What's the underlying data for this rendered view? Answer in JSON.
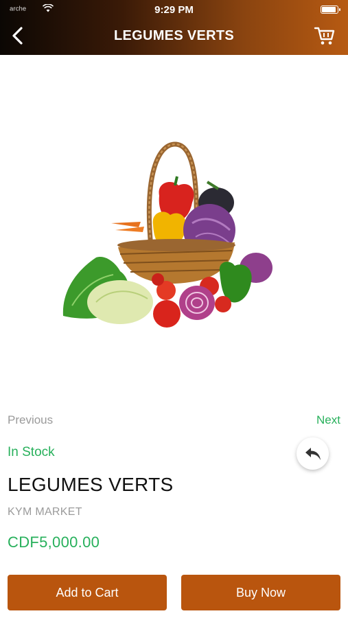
{
  "status_bar": {
    "carrier": "ᵃʳᶜʰᵉ",
    "time": "9:29 PM"
  },
  "header": {
    "title": "LEGUMES VERTS"
  },
  "image": {
    "subject": "basket of vegetables"
  },
  "pager": {
    "previous_label": "Previous",
    "next_label": "Next"
  },
  "product": {
    "stock_status": "In Stock",
    "name": "LEGUMES VERTS",
    "vendor": "KYM MARKET",
    "price": "CDF5,000.00"
  },
  "actions": {
    "add_to_cart_label": "Add to Cart",
    "buy_now_label": "Buy Now"
  },
  "colors": {
    "accent": "#b9550e",
    "in_stock": "#27b05b",
    "muted": "#9a9a9a"
  },
  "icons": {
    "back": "chevron-left-icon",
    "cart": "cart-icon",
    "share": "reply-icon"
  }
}
